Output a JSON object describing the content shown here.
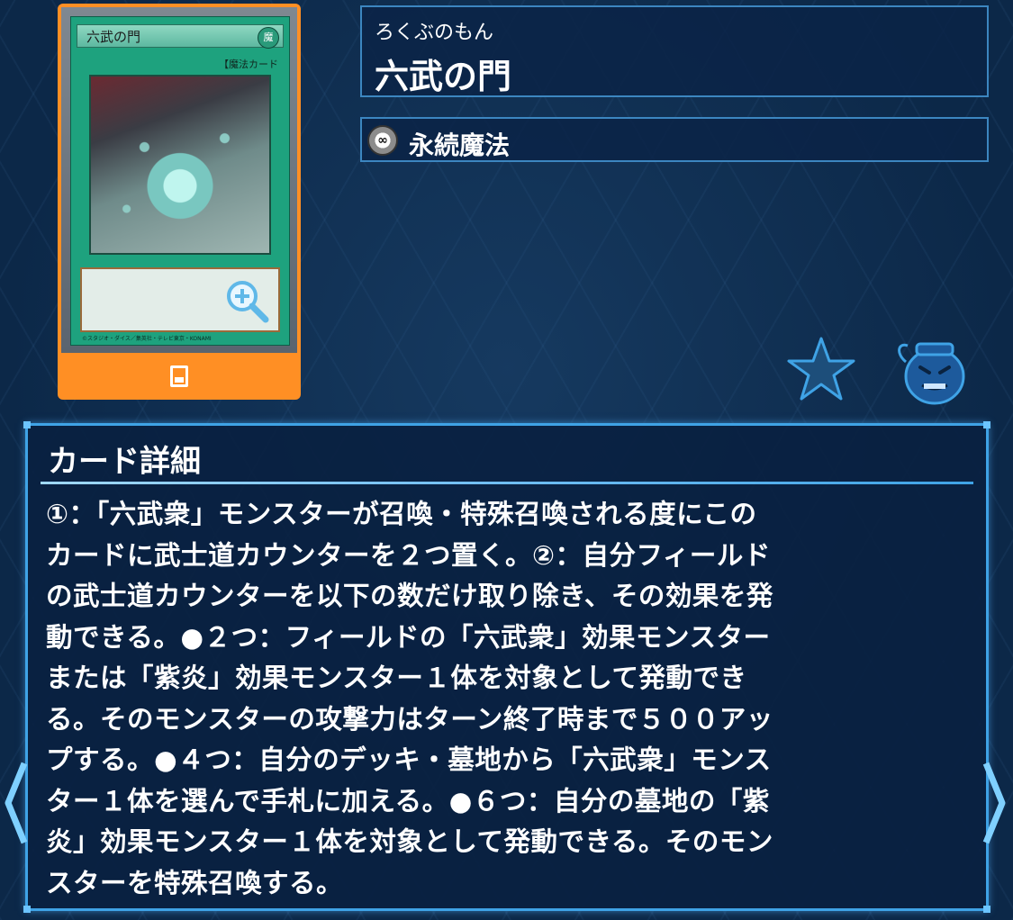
{
  "card_image": {
    "name": "六武の門",
    "attribute": "魔",
    "type_line": "【魔法カード",
    "copyright": "©スタジオ・ダイス／集英社・テレビ東京・KONAMI"
  },
  "card_name": {
    "reading": "ろくぶのもん",
    "name": "六武の門"
  },
  "card_type": {
    "icon": "continuous-spell-icon",
    "label": "永続魔法"
  },
  "details": {
    "title": "カード詳細",
    "text": "①：「六武衆」モンスターが召喚・特殊召喚される度にこの\nカードに武士道カウンターを２つ置く。②：自分フィールド\nの武士道カウンターを以下の数だけ取り除き、その効果を発\n動できる。●２つ：フィールドの「六武衆」効果モンスター\nまたは「紫炎」効果モンスター１体を対象として発動でき\nる。そのモンスターの攻撃力はターン終了時まで５００アッ\nプする。●４つ：自分のデッキ・墓地から「六武衆」モンス\nター１体を選んで手札に加える。●６つ：自分の墓地の「紫\n炎」効果モンスター１体を対象として発動できる。そのモン\nスターを特殊召喚する。"
  },
  "colors": {
    "accent": "#3fa3e6",
    "card_frame": "#ff8f24",
    "spell_green": "#1ea27e",
    "background": "#0c2848"
  }
}
